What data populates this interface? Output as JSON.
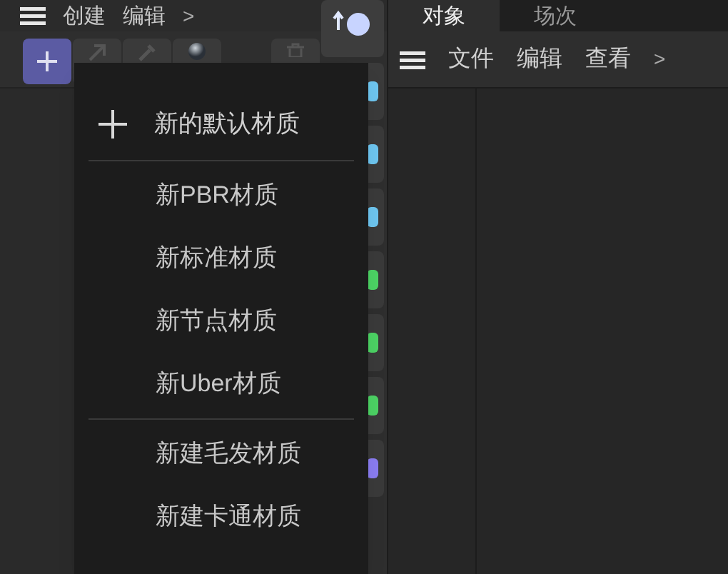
{
  "material_panel": {
    "menu": [
      "创建",
      "编辑"
    ],
    "more": ">",
    "toolbar": [
      {
        "kind": "add",
        "selected": true
      },
      {
        "kind": "arrow",
        "selected": false
      },
      {
        "kind": "eyedropper",
        "selected": false
      },
      {
        "kind": "sphere",
        "selected": false
      },
      {
        "kind": "trash",
        "selected": false
      }
    ]
  },
  "tabs": [
    {
      "label": "对象",
      "selected": true
    },
    {
      "label": "场次",
      "selected": false
    }
  ],
  "object_panel": {
    "menu": [
      "文件",
      "编辑",
      "查看"
    ],
    "more": ">"
  },
  "popup_menu": [
    {
      "kind": "add",
      "label": "新的默认材质"
    },
    {
      "kind": "separator"
    },
    {
      "kind": "item",
      "label": "新PBR材质"
    },
    {
      "kind": "item",
      "label": "新标准材质"
    },
    {
      "kind": "item",
      "label": "新节点材质"
    },
    {
      "kind": "item",
      "label": "新Uber材质"
    },
    {
      "kind": "separator"
    },
    {
      "kind": "item",
      "label": "新建毛发材质"
    },
    {
      "kind": "item",
      "label": "新建卡通材质"
    }
  ]
}
